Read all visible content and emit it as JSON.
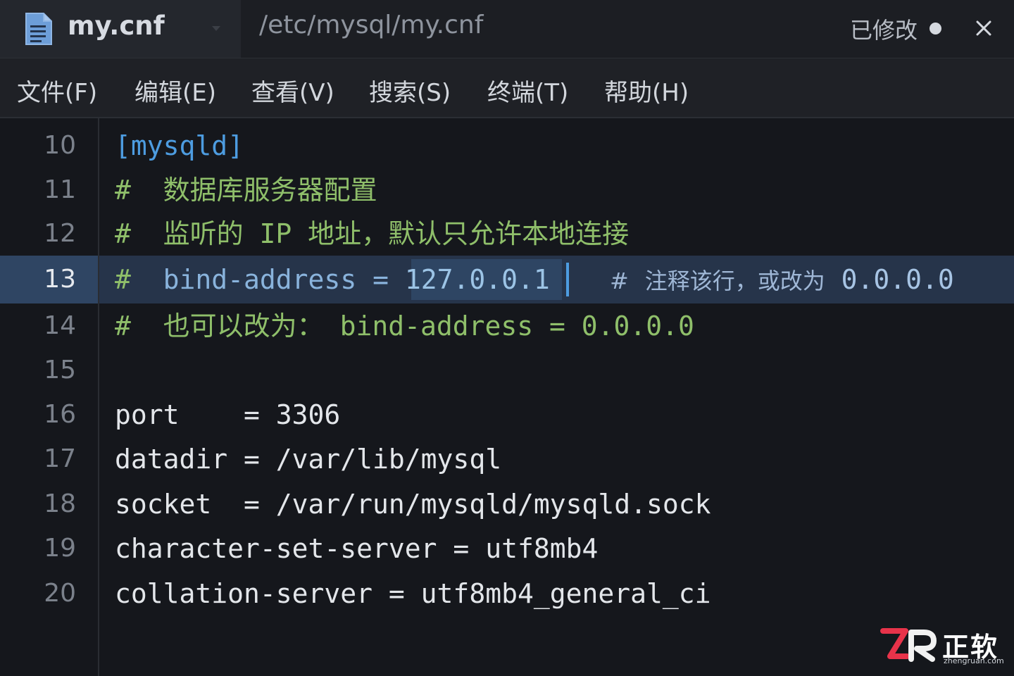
{
  "tab": {
    "file_name": "my.cnf",
    "path": "/etc/mysql/my.cnf",
    "status": "已修改",
    "icons": {
      "file": "document-icon",
      "dropdown": "chevron-down-icon",
      "modified": "dot-icon",
      "close": "close-icon"
    }
  },
  "menu": {
    "items": [
      {
        "label": "文件(F)"
      },
      {
        "label": "编辑(E)"
      },
      {
        "label": "查看(V)"
      },
      {
        "label": "搜索(S)"
      },
      {
        "label": "终端(T)"
      },
      {
        "label": "帮助(H)"
      }
    ]
  },
  "editor": {
    "current_line": "13",
    "lines": [
      {
        "num": "10",
        "section": "[mysqld]"
      },
      {
        "num": "11",
        "hash": "#",
        "comment": "数据库服务器配置"
      },
      {
        "num": "12",
        "hash": "#",
        "comment": "监听的 IP 地址，默认只允许本地连接"
      },
      {
        "num": "13",
        "hash": "#",
        "key": "bind-address",
        "eq": "=",
        "value": "127.0.0.1",
        "note_hash": "#",
        "note": "注释该行，或改为",
        "note_value": "0.0.0.0"
      },
      {
        "num": "14",
        "hash": "#",
        "comment": "也可以改为：",
        "tail": "bind-address = 0.0.0.0"
      },
      {
        "num": "15"
      },
      {
        "num": "16",
        "text": "port    = 3306"
      },
      {
        "num": "17",
        "text": "datadir = /var/lib/mysql"
      },
      {
        "num": "18",
        "text": "socket  = /var/run/mysqld/mysqld.sock"
      },
      {
        "num": "19",
        "text": "character-set-server = utf8mb4"
      },
      {
        "num": "20",
        "text": "collation-server = utf8mb4_general_ci"
      }
    ]
  },
  "watermark": {
    "logo": "ZR",
    "name": "正软",
    "url": "zhengruan.com"
  },
  "colors": {
    "accent": "#4d9ce0",
    "comment": "#8fbf6a",
    "current_line": "#26344a",
    "background": "#15171c"
  }
}
